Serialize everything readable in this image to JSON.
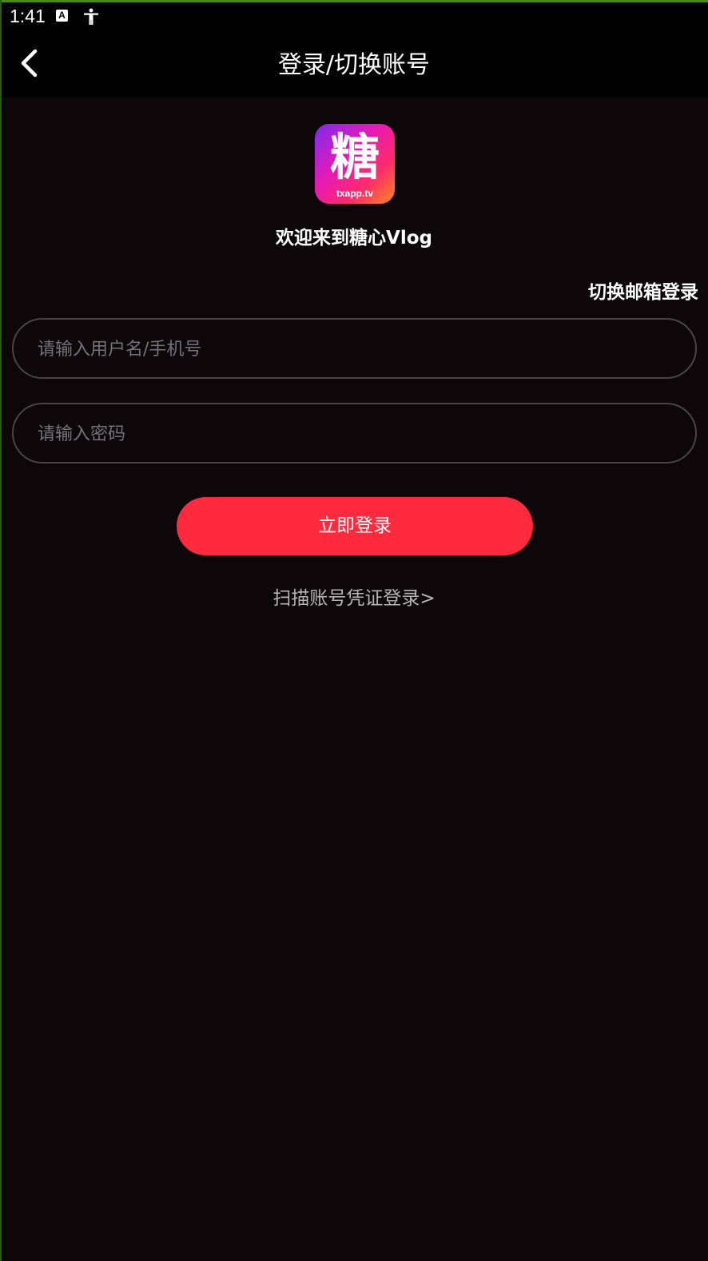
{
  "status_bar": {
    "time": "1:41",
    "icons": [
      "a-notification-icon",
      "accessibility-icon"
    ],
    "a_icon_letter": "A"
  },
  "header": {
    "title": "登录/切换账号",
    "back_icon": "chevron-left-icon"
  },
  "logo": {
    "char": "糖",
    "subtitle": "txapp.tv",
    "gradient": [
      "#7a2cf0",
      "#e61ab4",
      "#ff2a6a",
      "#ff8a1e"
    ]
  },
  "welcome": "欢迎来到糖心Vlog",
  "switch_email": "切换邮箱登录",
  "form": {
    "username_placeholder": "请输入用户名/手机号",
    "username_value": "",
    "password_placeholder": "请输入密码",
    "password_value": ""
  },
  "login_button": "立即登录",
  "scan_link": "扫描账号凭证登录>",
  "colors": {
    "background": "#0e070a",
    "header": "#000000",
    "accent": "#ff2a3e",
    "input_border": "#4a4448",
    "placeholder": "#77707a",
    "secondary_text": "#b7b2b5"
  }
}
